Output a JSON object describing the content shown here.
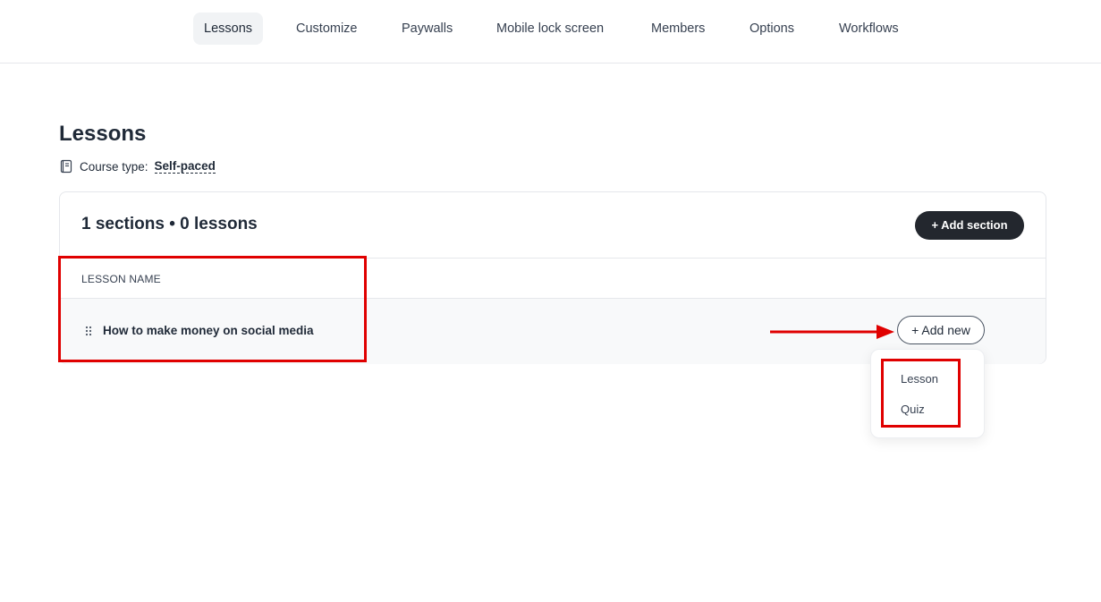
{
  "nav": {
    "tabs": [
      {
        "label": "Lessons",
        "active": true
      },
      {
        "label": "Customize",
        "active": false
      },
      {
        "label": "Paywalls",
        "active": false
      },
      {
        "label": "Mobile lock screen",
        "active": false
      },
      {
        "label": "Members",
        "active": false
      },
      {
        "label": "Options",
        "active": false
      },
      {
        "label": "Workflows",
        "active": false
      }
    ]
  },
  "page": {
    "title": "Lessons",
    "course_type_label": "Course type:",
    "course_type_value": "Self-paced"
  },
  "card": {
    "summary": "1 sections • 0 lessons",
    "add_section_label": "+ Add section",
    "column_header": "LESSON NAME",
    "rows": [
      {
        "title": "How to make money on social media",
        "add_new_label": "+ Add new"
      }
    ]
  },
  "dropdown": {
    "items": [
      {
        "label": "Lesson"
      },
      {
        "label": "Quiz"
      }
    ]
  },
  "icons": {
    "book": "book-icon",
    "drag": "drag-handle-icon",
    "arrow": "annotation-arrow-icon"
  },
  "colors": {
    "annotation": "#e00000",
    "primary_button": "#23272e",
    "active_tab_bg": "#f1f3f5",
    "row_bg": "#f8f9fa"
  }
}
